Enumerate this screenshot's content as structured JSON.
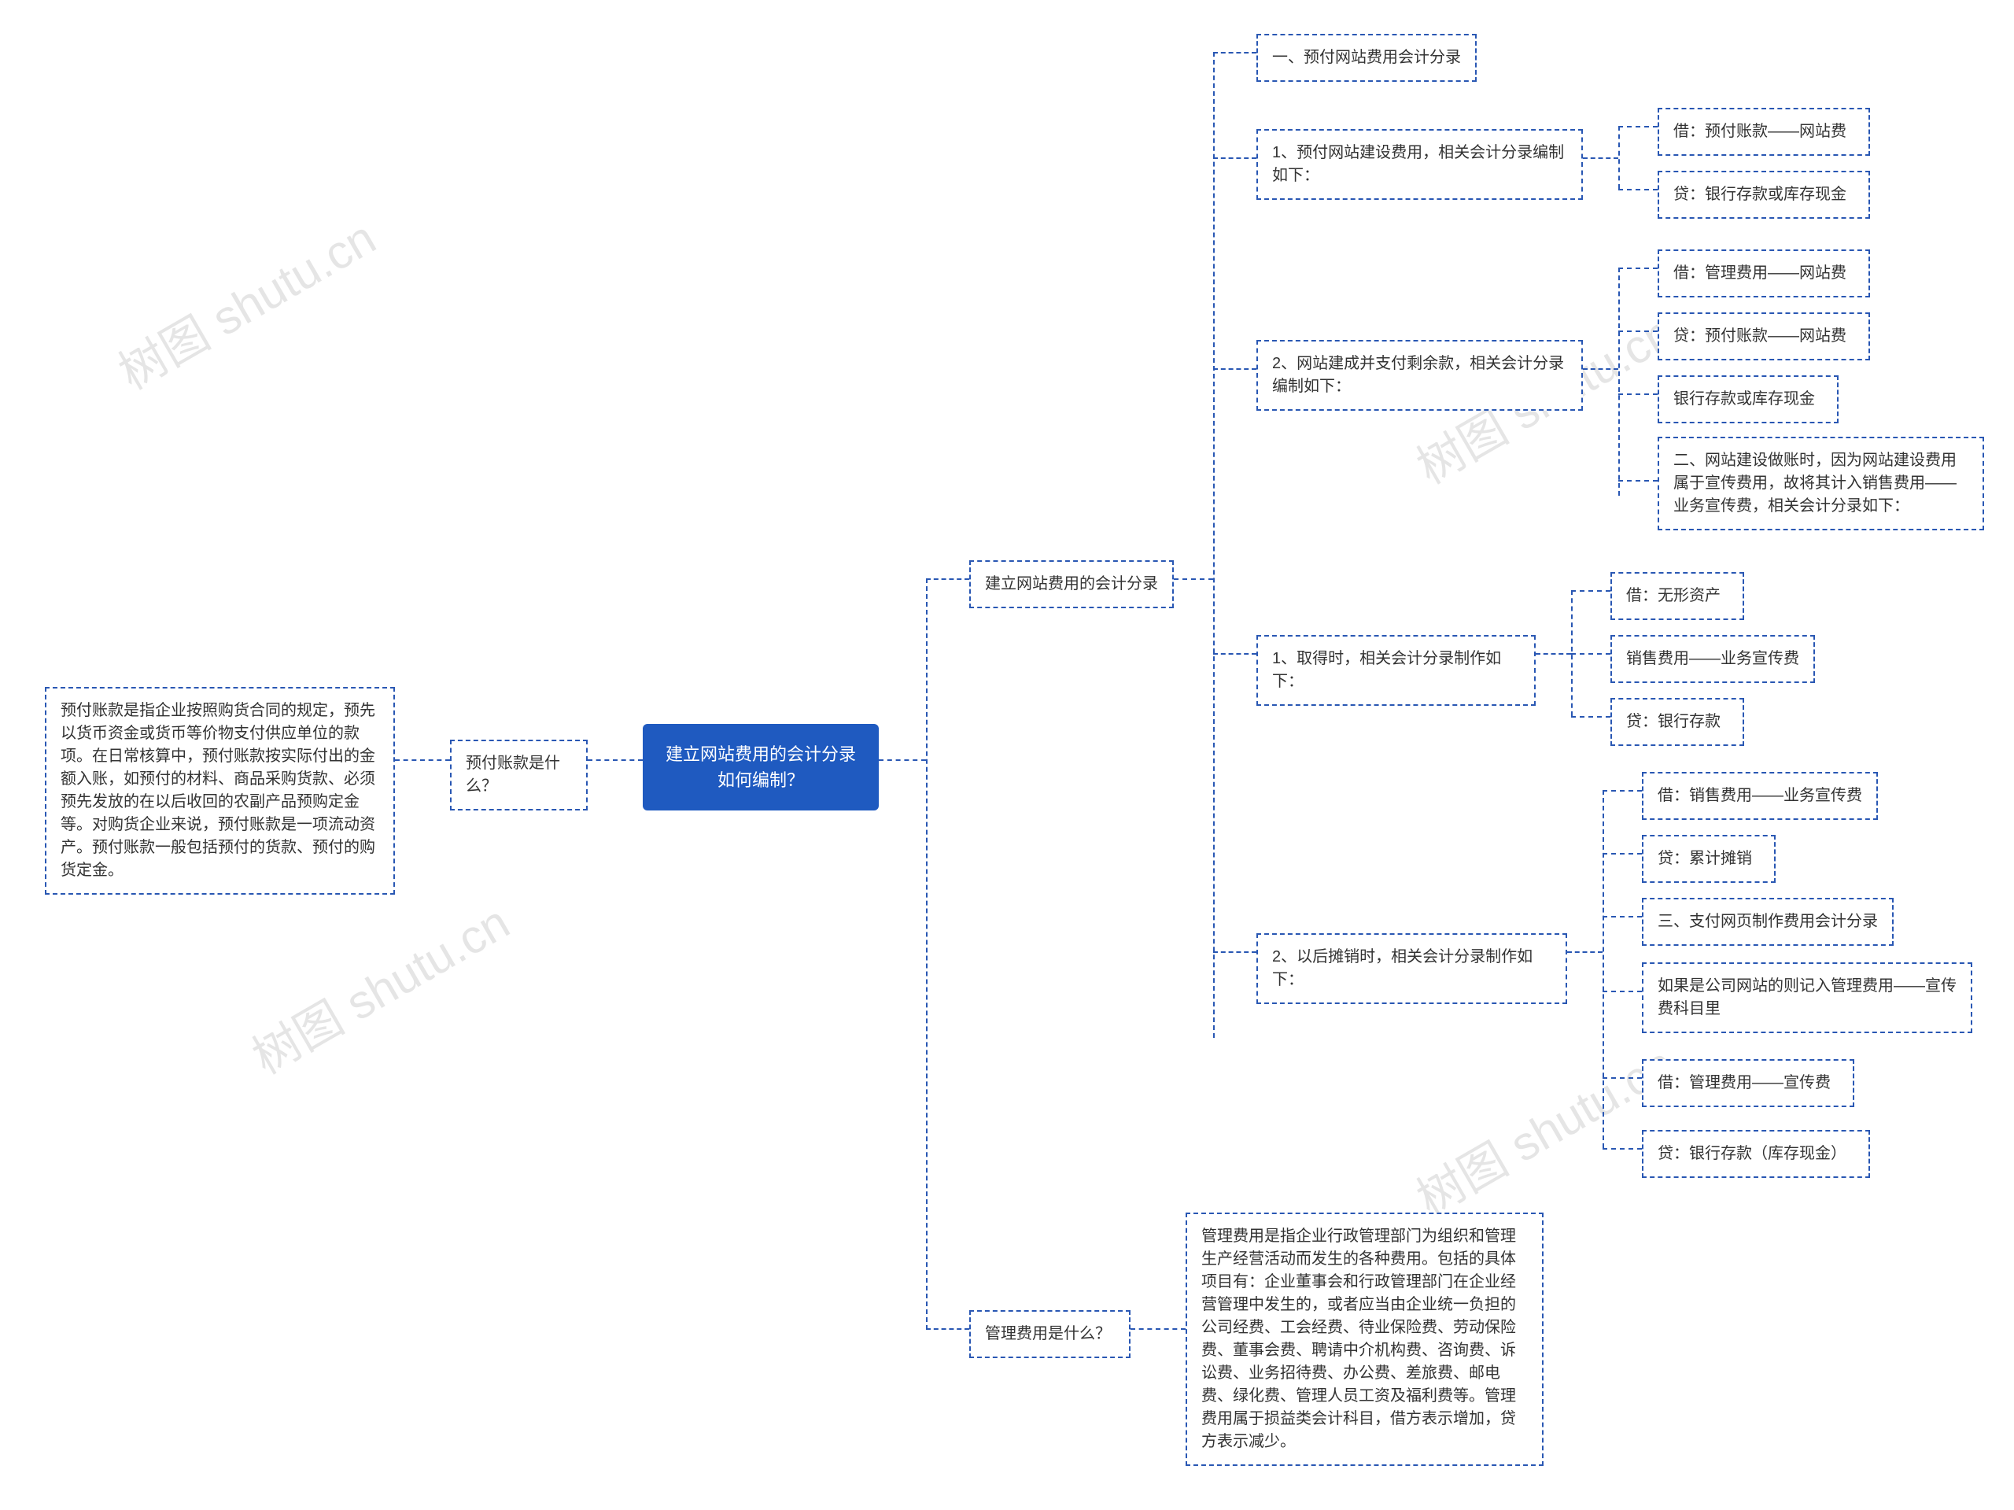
{
  "watermark": "树图 shutu.cn",
  "root": {
    "title_l1": "建立网站费用的会计分录",
    "title_l2": "如何编制？"
  },
  "left": {
    "q1": "预付账款是什么？",
    "q1_detail": "预付账款是指企业按照购货合同的规定，预先以货币资金或货币等价物支付供应单位的款项。在日常核算中，预付账款按实际付出的金额入账，如预付的材料、商品采购货款、必须预先发放的在以后收回的农副产品预购定金等。对购货企业来说，预付账款是一项流动资产。预付账款一般包括预付的货款、预付的购货定金。"
  },
  "right": {
    "b1": "建立网站费用的会计分录",
    "b1_1": "一、预付网站费用会计分录",
    "b1_2": "1、预付网站建设费用，相关会计分录编制如下：",
    "b1_2_a": "借：预付账款——网站费",
    "b1_2_b": "贷：银行存款或库存现金",
    "b1_3": "2、网站建成并支付剩余款，相关会计分录编制如下：",
    "b1_3_a": "借：管理费用——网站费",
    "b1_3_b": "贷：预付账款——网站费",
    "b1_3_c": "银行存款或库存现金",
    "b1_3_d": "二、网站建设做账时，因为网站建设费用属于宣传费用，故将其计入销售费用——业务宣传费，相关会计分录如下：",
    "b1_4": "1、取得时，相关会计分录制作如下：",
    "b1_4_a": "借：无形资产",
    "b1_4_b": "销售费用——业务宣传费",
    "b1_4_c": "贷：银行存款",
    "b1_5": "2、以后摊销时，相关会计分录制作如下：",
    "b1_5_a": "借：销售费用——业务宣传费",
    "b1_5_b": "贷：累计摊销",
    "b1_5_c": "三、支付网页制作费用会计分录",
    "b1_5_d": "如果是公司网站的则记入管理费用——宣传费科目里",
    "b1_5_e": "借：管理费用——宣传费",
    "b1_5_f": "贷：银行存款（库存现金）",
    "b2": "管理费用是什么？",
    "b2_detail": "管理费用是指企业行政管理部门为组织和管理生产经营活动而发生的各种费用。包括的具体项目有：企业董事会和行政管理部门在企业经营管理中发生的，或者应当由企业统一负担的公司经费、工会经费、待业保险费、劳动保险费、董事会费、聘请中介机构费、咨询费、诉讼费、业务招待费、办公费、差旅费、邮电费、绿化费、管理人员工资及福利费等。管理费用属于损益类会计科目，借方表示增加，贷方表示减少。"
  }
}
